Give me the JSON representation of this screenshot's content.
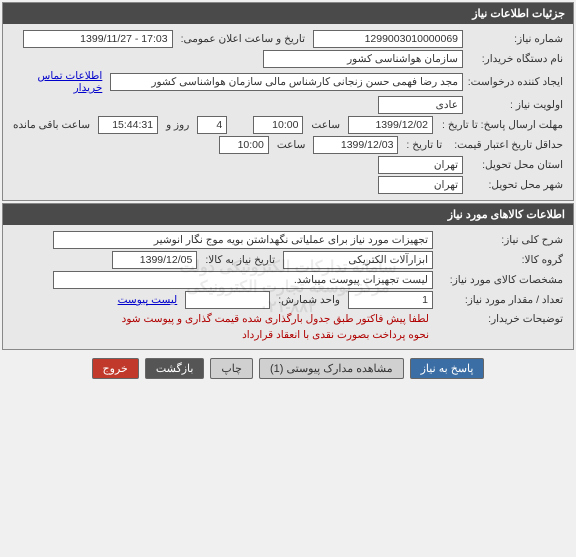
{
  "panel1": {
    "title": "جزئیات اطلاعات نیاز",
    "need_number_label": "شماره نیاز:",
    "need_number": "1299003010000069",
    "announce_label": "تاریخ و ساعت اعلان عمومی:",
    "announce_value": "17:03 - 1399/11/27",
    "buyer_org_label": "نام دستگاه خریدار:",
    "buyer_org": "سازمان هواشناسی کشور",
    "requester_label": "ایجاد کننده درخواست:",
    "requester": "مجد رضا فهمی حسن زنجانی کارشناس مالی سازمان هواشناسی کشور",
    "contact_link": "اطلاعات تماس خریدار",
    "priority_label": "اولویت نیاز :",
    "priority": "عادی",
    "deadline_label": "مهلت ارسال پاسخ:  تا تاریخ :",
    "deadline_date": "1399/12/02",
    "time_label": "ساعت",
    "deadline_time": "10:00",
    "days": "4",
    "days_label": "روز و",
    "remaining_time": "15:44:31",
    "remaining_label": "ساعت باقی مانده",
    "validity_label": "حداقل تاریخ اعتبار قیمت:",
    "validity_to_label": "تا تاریخ :",
    "validity_date": "1399/12/03",
    "validity_time": "10:00",
    "province_label": "استان محل تحویل:",
    "province": "تهران",
    "city_label": "شهر محل تحویل:",
    "city": "تهران"
  },
  "panel2": {
    "title": "اطلاعات کالاهای مورد نیاز",
    "desc_label": "شرح کلی نیاز:",
    "desc": "تجهیزات مورد نیاز برای عملیاتی نگهداشتن بویه موج نگار انوشیر",
    "group_label": "گروه کالا:",
    "group": "ابزارآلات الکتریکی",
    "need_date_label": "تاریخ نیاز به کالا:",
    "need_date": "1399/12/05",
    "spec_label": "مشخصات کالای مورد نیاز:",
    "spec": "لیست تجهیزات پیوست میباشد.",
    "qty_label": "تعداد / مقدار مورد نیاز:",
    "qty": "1",
    "unit_label": "واحد شمارش:",
    "unit": "",
    "attach_link": "لیست پیوست",
    "notes_label": "توضیحات خریدار:",
    "notes_line1": "لطفا پیش فاکتور طبق جدول بارگذاری شده قیمت گذاری و پیوست شود",
    "notes_line2": "نحوه پرداخت بصورت نقدی با انعقاد قرارداد",
    "watermark": "سامانه تدارکات الکترونیکی دولت\nمرکز توسعه تجارت الکترونیکی\n۰۲۱-۸۸۲"
  },
  "footer": {
    "respond": "پاسخ به نیاز",
    "view_attach": "مشاهده مدارک پیوستی (1)",
    "print": "چاپ",
    "back": "بازگشت",
    "exit": "خروج"
  }
}
